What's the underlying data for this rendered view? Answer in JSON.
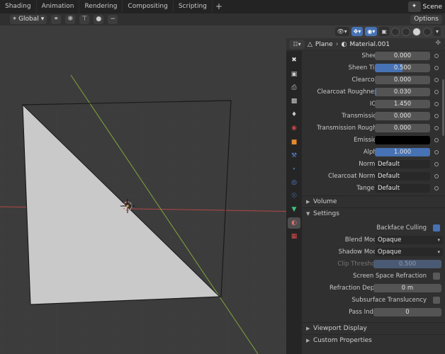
{
  "topbar": {
    "tabs": [
      "Shading",
      "Animation",
      "Rendering",
      "Compositing",
      "Scripting"
    ],
    "add": "+",
    "scene_label": "Scene"
  },
  "vpheader": {
    "orientation": "Global",
    "options": "Options"
  },
  "props": {
    "crumbs": {
      "object": "Plane",
      "material": "Material.001"
    },
    "rows": [
      {
        "label": "Sheen",
        "value": "0.000"
      },
      {
        "label": "Sheen Tint",
        "value": "0.500",
        "fill": 0.5
      },
      {
        "label": "Clearcoat",
        "value": "0.000"
      },
      {
        "label": "Clearcoat Roughness",
        "value": "0.030",
        "fill": 0.03
      },
      {
        "label": "IOR",
        "value": "1.450"
      },
      {
        "label": "Transmission",
        "value": "0.000"
      },
      {
        "label": "Transmission Rough..",
        "value": "0.000"
      },
      {
        "label": "Emission",
        "value": ""
      },
      {
        "label": "Alpha",
        "value": "1.000",
        "fill": 1.0
      },
      {
        "label": "Normal",
        "value": "Default"
      },
      {
        "label": "Clearcoat Normal",
        "value": "Default"
      },
      {
        "label": "Tangent",
        "value": "Default"
      }
    ],
    "panels": {
      "volume": "Volume",
      "settings": "Settings",
      "viewport_display": "Viewport Display",
      "custom_properties": "Custom Properties"
    },
    "settings": {
      "backface_culling": "Backface Culling",
      "blend_mode_label": "Blend Mode",
      "blend_mode": "Opaque",
      "shadow_mode_label": "Shadow Mode",
      "shadow_mode": "Opaque",
      "clip_threshold_label": "Clip Threshold",
      "clip_threshold": "0.500",
      "ssr_label": "Screen Space Refraction",
      "refraction_depth_label": "Refraction Depth",
      "refraction_depth": "0 m",
      "subsurface_label": "Subsurface Translucency",
      "pass_index_label": "Pass Index",
      "pass_index": "0"
    }
  },
  "colors": {
    "accent": "#4772b3",
    "plane_fill": "#c9c9c9",
    "x_axis": "#b54646",
    "y_axis": "#7ea63a"
  }
}
